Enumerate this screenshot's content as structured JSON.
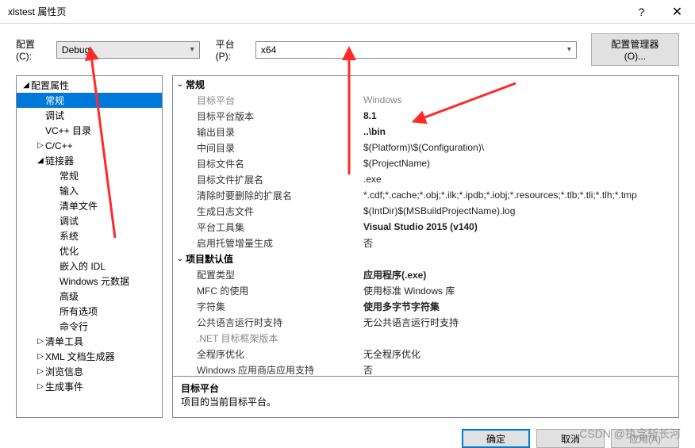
{
  "title": "xlstest 属性页",
  "config_row": {
    "config_label": "配置(C):",
    "config_value": "Debug",
    "platform_label": "平台(P):",
    "platform_value": "x64",
    "manager_btn": "配置管理器(O)..."
  },
  "tree": [
    {
      "label": "配置属性",
      "level": 1,
      "exp": "◢"
    },
    {
      "label": "常规",
      "level": 2,
      "selected": true
    },
    {
      "label": "调试",
      "level": 2
    },
    {
      "label": "VC++ 目录",
      "level": 2
    },
    {
      "label": "C/C++",
      "level": 2,
      "exp": "▷"
    },
    {
      "label": "链接器",
      "level": 2,
      "exp": "◢"
    },
    {
      "label": "常规",
      "level": 3
    },
    {
      "label": "输入",
      "level": 3
    },
    {
      "label": "清单文件",
      "level": 3
    },
    {
      "label": "调试",
      "level": 3
    },
    {
      "label": "系统",
      "level": 3
    },
    {
      "label": "优化",
      "level": 3
    },
    {
      "label": "嵌入的 IDL",
      "level": 3
    },
    {
      "label": "Windows 元数据",
      "level": 3
    },
    {
      "label": "高级",
      "level": 3
    },
    {
      "label": "所有选项",
      "level": 3
    },
    {
      "label": "命令行",
      "level": 3
    },
    {
      "label": "清单工具",
      "level": 2,
      "exp": "▷"
    },
    {
      "label": "XML 文档生成器",
      "level": 2,
      "exp": "▷"
    },
    {
      "label": "浏览信息",
      "level": 2,
      "exp": "▷"
    },
    {
      "label": "生成事件",
      "level": 2,
      "exp": "▷"
    }
  ],
  "props": [
    {
      "type": "section",
      "key": "常规"
    },
    {
      "key": "目标平台",
      "val": "Windows",
      "disabled": true
    },
    {
      "key": "目标平台版本",
      "val": "8.1",
      "bold": true
    },
    {
      "key": "输出目录",
      "val": "..\\bin",
      "bold": true
    },
    {
      "key": "中间目录",
      "val": "$(Platform)\\$(Configuration)\\"
    },
    {
      "key": "目标文件名",
      "val": "$(ProjectName)"
    },
    {
      "key": "目标文件扩展名",
      "val": ".exe"
    },
    {
      "key": "清除时要删除的扩展名",
      "val": "*.cdf;*.cache;*.obj;*.ilk;*.ipdb;*.iobj;*.resources;*.tlb;*.tli;*.tlh;*.tmp"
    },
    {
      "key": "生成日志文件",
      "val": "$(IntDir)$(MSBuildProjectName).log"
    },
    {
      "key": "平台工具集",
      "val": "Visual Studio 2015 (v140)",
      "bold": true
    },
    {
      "key": "启用托管增量生成",
      "val": "否"
    },
    {
      "type": "section",
      "key": "项目默认值"
    },
    {
      "key": "配置类型",
      "val": "应用程序(.exe)",
      "bold": true
    },
    {
      "key": "MFC 的使用",
      "val": "使用标准 Windows 库"
    },
    {
      "key": "字符集",
      "val": "使用多字节字符集",
      "bold": true
    },
    {
      "key": "公共语言运行时支持",
      "val": "无公共语言运行时支持"
    },
    {
      "key": ".NET 目标框架版本",
      "val": "",
      "disabled": true
    },
    {
      "key": "全程序优化",
      "val": "无全程序优化"
    },
    {
      "key": "Windows 应用商店应用支持",
      "val": "否"
    }
  ],
  "desc": {
    "title": "目标平台",
    "text": "项目的当前目标平台。"
  },
  "footer": {
    "ok": "确定",
    "cancel": "取消",
    "apply": "应用(A)"
  },
  "watermark": "CSDN @执念斩长河"
}
